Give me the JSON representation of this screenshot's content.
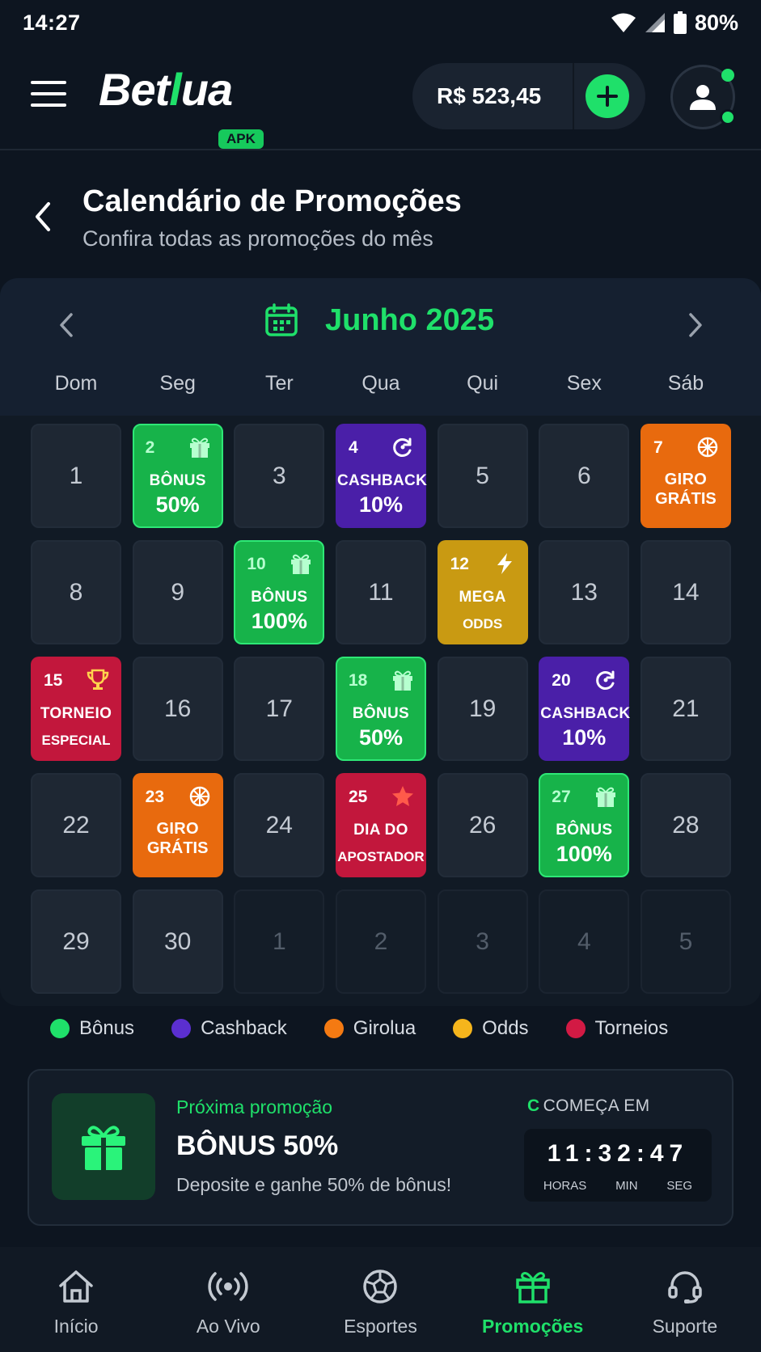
{
  "status_bar": {
    "time": "14:27",
    "battery": "80%"
  },
  "header": {
    "logo_main": "Bet",
    "logo_accent": "l",
    "logo_end": "ua",
    "logo_badge": "APK",
    "balance": "R$ 523,45",
    "menu_icon": "hamburger-icon",
    "add_icon": "plus-icon",
    "avatar_icon": "user-icon"
  },
  "page": {
    "title": "Calendário de Promoções",
    "subtitle": "Confira todas as promoções do mês"
  },
  "calendar": {
    "month": "Junho 2025",
    "weekdays": [
      "Dom",
      "Seg",
      "Ter",
      "Qua",
      "Qui",
      "Sex",
      "Sáb"
    ],
    "rows": [
      [
        {
          "num": "1"
        },
        {
          "num": "2",
          "type": "bonus",
          "icon": "gift-icon",
          "l1": "BÔNUS",
          "l2": "50%"
        },
        {
          "num": "3"
        },
        {
          "num": "4",
          "type": "cashback",
          "icon": "refresh-icon",
          "l1": "CASHBACK",
          "l2": "10%"
        },
        {
          "num": "5"
        },
        {
          "num": "6"
        },
        {
          "num": "7",
          "type": "girolua",
          "icon": "wheel-icon",
          "l1": "GIRO",
          "l2": "GRÁTIS"
        }
      ],
      [
        {
          "num": "8"
        },
        {
          "num": "9"
        },
        {
          "num": "10",
          "type": "bonus",
          "icon": "gift-icon",
          "l1": "BÔNUS",
          "l2": "100%"
        },
        {
          "num": "11"
        },
        {
          "num": "12",
          "type": "odds",
          "icon": "bolt-icon",
          "l1": "MEGA",
          "l2": "ODDS"
        },
        {
          "num": "13"
        },
        {
          "num": "14"
        }
      ],
      [
        {
          "num": "15",
          "type": "torneio",
          "icon": "trophy-icon",
          "l1": "TORNEIO",
          "l2": "ESPECIAL"
        },
        {
          "num": "16"
        },
        {
          "num": "17"
        },
        {
          "num": "18",
          "type": "bonus",
          "icon": "gift-icon",
          "l1": "BÔNUS",
          "l2": "50%"
        },
        {
          "num": "19"
        },
        {
          "num": "20",
          "type": "cashback",
          "icon": "refresh-icon",
          "l1": "CASHBACK",
          "l2": "10%"
        },
        {
          "num": "21"
        }
      ],
      [
        {
          "num": "22"
        },
        {
          "num": "23",
          "type": "girolua",
          "icon": "wheel-icon",
          "l1": "GIRO",
          "l2": "GRÁTIS"
        },
        {
          "num": "24"
        },
        {
          "num": "25",
          "type": "torneio",
          "icon": "star-icon",
          "l1": "DIA DO",
          "l2": "APOSTADOR"
        },
        {
          "num": "26"
        },
        {
          "num": "27",
          "type": "bonus",
          "icon": "gift-icon",
          "l1": "BÔNUS",
          "l2": "100%"
        },
        {
          "num": "28"
        }
      ],
      [
        {
          "num": "29"
        },
        {
          "num": "30"
        },
        {
          "num": "1",
          "muted": true
        },
        {
          "num": "2",
          "muted": true
        },
        {
          "num": "3",
          "muted": true
        },
        {
          "num": "4",
          "muted": true
        },
        {
          "num": "5",
          "muted": true
        }
      ]
    ]
  },
  "legend": [
    {
      "label": "Bônus",
      "color": "#1fe06a"
    },
    {
      "label": "Cashback",
      "color": "#5b2fd0"
    },
    {
      "label": "Girolua",
      "color": "#f47a12"
    },
    {
      "label": "Odds",
      "color": "#f5b51c"
    },
    {
      "label": "Torneios",
      "color": "#d21a44"
    }
  ],
  "next_promo": {
    "label": "Próxima promoção",
    "title": "BÔNUS 50%",
    "description": "Deposite e ganhe 50% de bônus!",
    "starts_prefix": "C",
    "starts_label": "COMEÇA EM",
    "countdown": "11:32:47",
    "units": [
      "HORAS",
      "MIN",
      "SEG"
    ]
  },
  "bottom_nav": [
    {
      "label": "Início",
      "icon": "home-icon",
      "active": false
    },
    {
      "label": "Ao Vivo",
      "icon": "broadcast-icon",
      "active": false
    },
    {
      "label": "Esportes",
      "icon": "soccer-ball-icon",
      "active": false
    },
    {
      "label": "Promoções",
      "icon": "gift-icon",
      "active": true
    },
    {
      "label": "Suporte",
      "icon": "headset-icon",
      "active": false
    }
  ],
  "colors": {
    "accent": "#1fe06a",
    "background": "#0d1520",
    "bonus": "#17b34a",
    "cashback": "#4a1fa8",
    "girolua": "#e86a0e",
    "odds": "#c99a12",
    "torneio": "#c2173c"
  }
}
